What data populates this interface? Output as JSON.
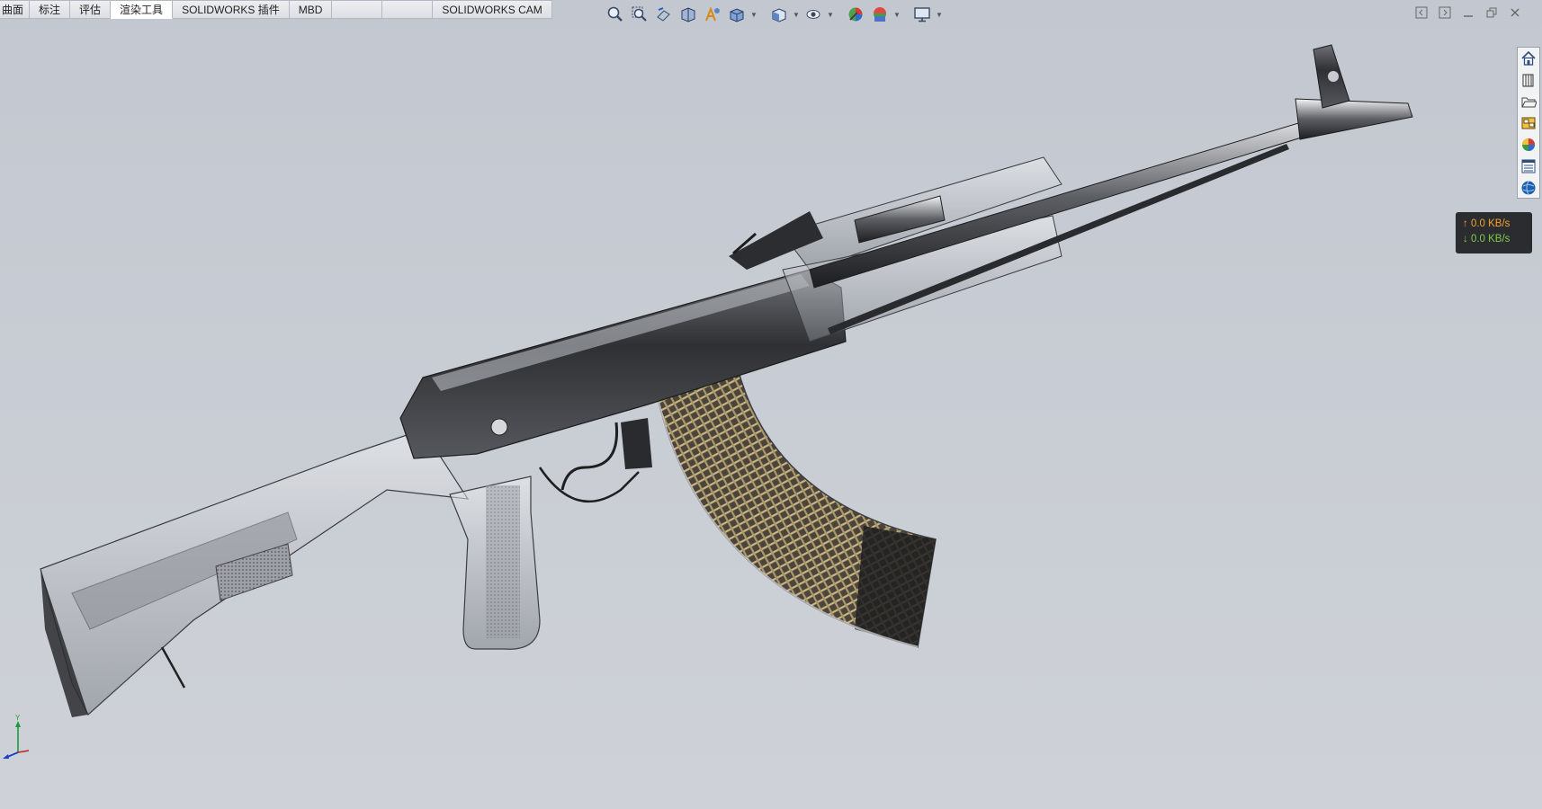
{
  "tabs": [
    {
      "label": "曲面",
      "active": false
    },
    {
      "label": "标注",
      "active": false
    },
    {
      "label": "评估",
      "active": false
    },
    {
      "label": "渲染工具",
      "active": true
    },
    {
      "label": "SOLIDWORKS 插件",
      "active": false
    },
    {
      "label": "MBD",
      "active": false
    },
    {
      "label": "",
      "active": false
    },
    {
      "label": "",
      "active": false
    },
    {
      "label": "SOLIDWORKS CAM",
      "active": false
    }
  ],
  "hud_toolbar": [
    "zoom-to-fit-icon",
    "zoom-to-area-icon",
    "previous-view-icon",
    "section-view-icon",
    "dynamic-annotation-icon",
    "view-orientation-icon",
    "display-style-icon",
    "hide-show-icon",
    "edit-appearance-icon",
    "apply-scene-icon",
    "view-settings-icon"
  ],
  "task_pane": [
    "home-icon",
    "design-library-icon",
    "file-explorer-icon",
    "view-palette-icon",
    "appearances-icon",
    "custom-properties-icon",
    "forum-icon"
  ],
  "network": {
    "upload": "↑ 0.0 KB/s",
    "download": "↓ 0.0 KB/s"
  },
  "triad": {
    "y_label": "Y"
  },
  "colors": {
    "viewport_bg": "#c7cbd2",
    "accent": "#1e5fc8",
    "upload": "#f0a52a",
    "download": "#7dcc4a"
  }
}
